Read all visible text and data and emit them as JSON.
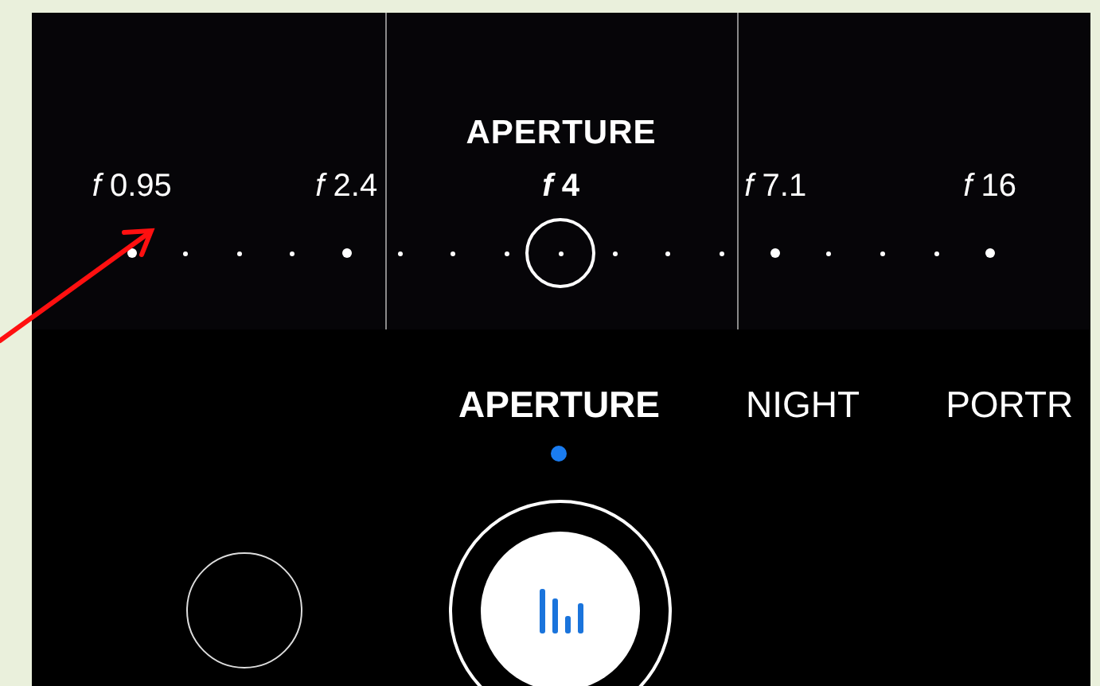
{
  "aperture_panel": {
    "title": "APERTURE",
    "stops": [
      {
        "label": "*f* 0.95",
        "selected": false
      },
      {
        "label": "*f* 2.4",
        "selected": false
      },
      {
        "label": "*f* 4",
        "selected": true
      },
      {
        "label": "*f* 7.1",
        "selected": false
      },
      {
        "label": "*f* 16",
        "selected": false
      }
    ]
  },
  "modes": [
    {
      "label": "APERTURE",
      "selected": true
    },
    {
      "label": "NIGHT",
      "selected": false
    },
    {
      "label": "PORTR",
      "selected": false
    }
  ]
}
